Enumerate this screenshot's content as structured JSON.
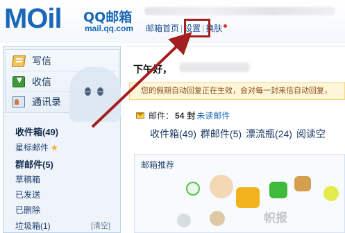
{
  "header": {
    "logo_text": "MOil",
    "logo_brand": "QQ邮箱",
    "logo_domain": "mail.qq.com",
    "nav": {
      "home": "邮箱首页",
      "separator": "|",
      "settings": "设置",
      "skin": "换肤"
    }
  },
  "sidebar": {
    "commands": [
      {
        "label": "写信",
        "icon": "write-icon"
      },
      {
        "label": "收信",
        "icon": "inbox-icon"
      },
      {
        "label": "通讯录",
        "icon": "contacts-icon"
      }
    ],
    "folders": [
      {
        "label": "收件箱(49)",
        "bold": true
      },
      {
        "label": "星标邮件",
        "bold": false,
        "starred": true
      },
      {
        "label": "群邮件(5)",
        "bold": true
      },
      {
        "label": "草稿箱",
        "bold": false
      },
      {
        "label": "已发送",
        "bold": false
      },
      {
        "label": "已删除",
        "bold": false
      },
      {
        "label": "垃圾箱(1)",
        "bold": false
      }
    ],
    "clear_label": "[清空]"
  },
  "main": {
    "greeting": "下午好，",
    "notice": "您的假期自动回复正在生效，会对每一封来信自动回复，",
    "mail_count": {
      "prefix": "邮件：",
      "count": "54",
      "unit": "封",
      "suffix": "未读邮件"
    },
    "tabs": [
      "收件箱(49)",
      "群邮件(5)",
      "漂流瓶(24)",
      "阅读空"
    ],
    "recommend_title": "邮箱推荐"
  },
  "colors": {
    "brand_blue": "#1a68b8",
    "highlight_red": "#a31f1f",
    "notice_bg": "#fff6d8"
  },
  "watermark": "帜报"
}
